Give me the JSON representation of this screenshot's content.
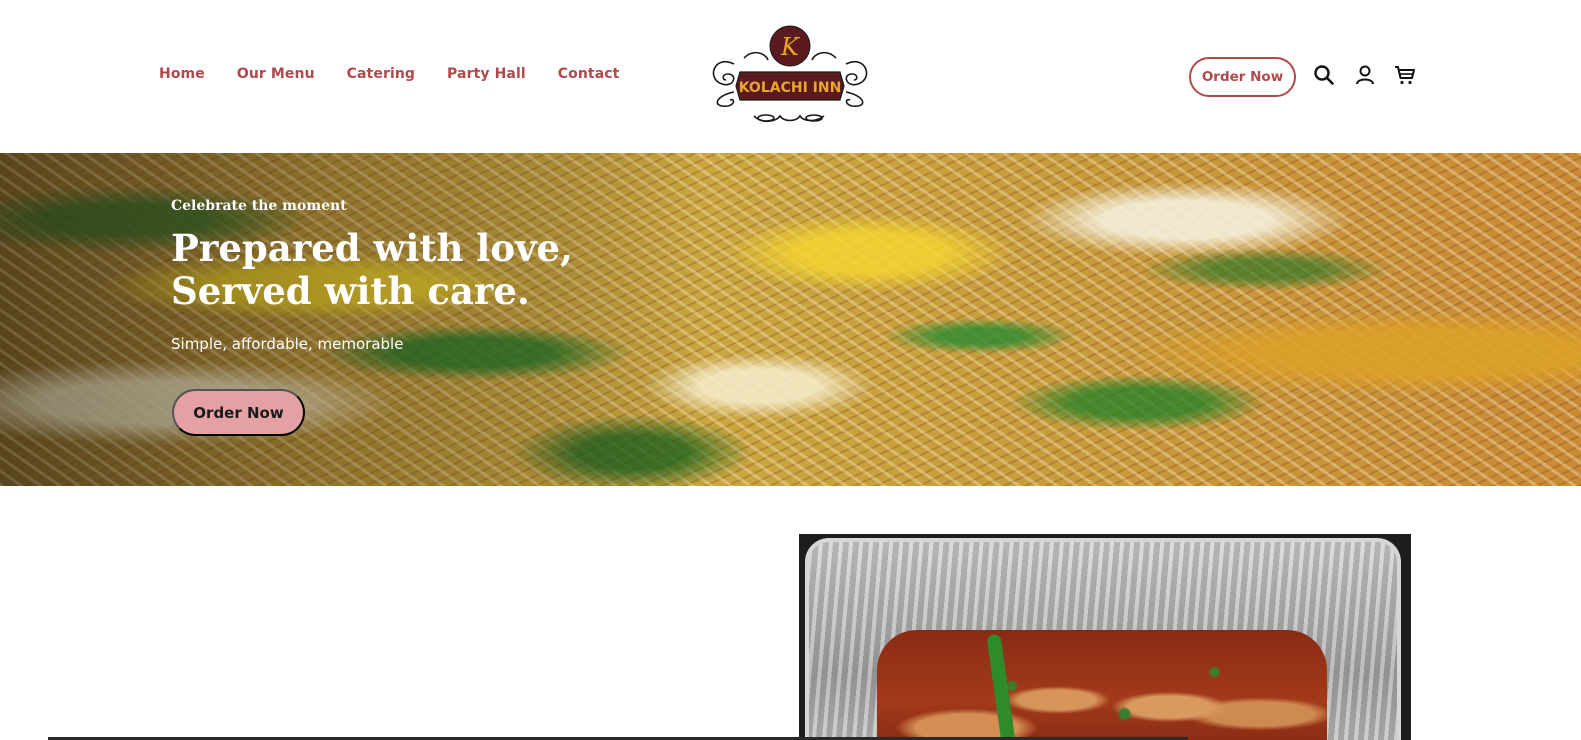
{
  "nav": {
    "items": [
      "Home",
      "Our Menu",
      "Catering",
      "Party Hall",
      "Contact"
    ]
  },
  "logo": {
    "monogram": "K",
    "name": "KOLACHI INN"
  },
  "header_actions": {
    "order_label": "Order Now",
    "icons": [
      "search-icon",
      "account-icon",
      "cart-icon"
    ]
  },
  "hero": {
    "eyebrow": "Celebrate the moment",
    "title_line1": "Prepared with love,",
    "title_line2": "Served with care.",
    "subtitle": "Simple, affordable, memorable",
    "cta_label": "Order Now"
  },
  "colors": {
    "accent": "#b0494c",
    "cta_fill": "#e5a0a4",
    "logo_maroon": "#5a1a1e",
    "logo_gold": "#e8a62a"
  }
}
